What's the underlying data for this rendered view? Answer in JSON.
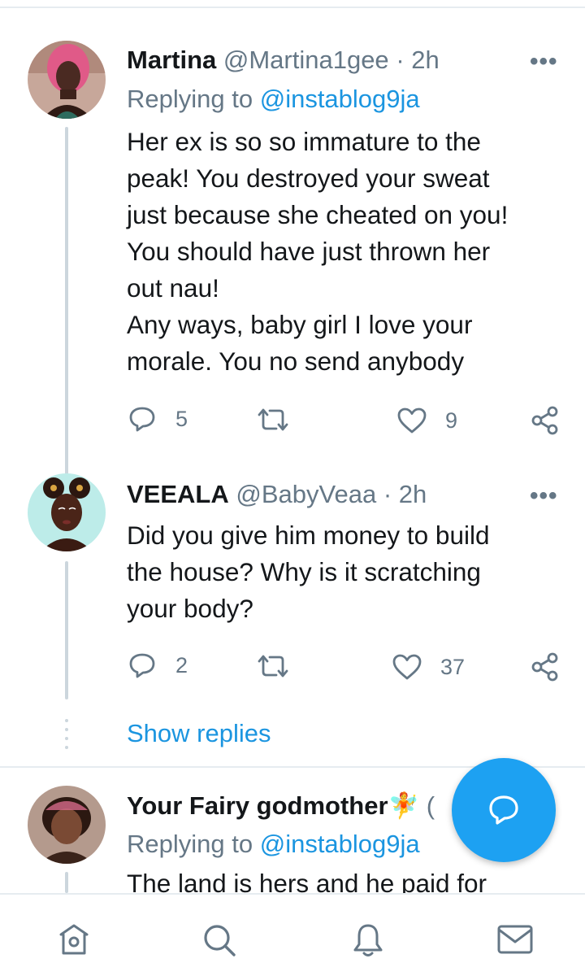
{
  "tweets": [
    {
      "name": "Martina",
      "handle": "@Martina1gee",
      "time": "· 2h",
      "replying_prefix": "Replying to ",
      "replying_to": "@instablog9ja",
      "lines": [
        "Her ex is so so immature to the",
        "peak! You destroyed your sweat",
        "just because she cheated on you!",
        "You should have just thrown her",
        "out nau!",
        "Any ways, baby girl I love your",
        "morale. You no send anybody"
      ],
      "replies": "5",
      "likes": "9"
    },
    {
      "name": "VEEALA",
      "handle": "@BabyVeaa",
      "time": "· 2h",
      "lines": [
        "Did you give him money to build",
        "the house?  Why is it scratching",
        "your body?"
      ],
      "replies": "2",
      "likes": "37"
    },
    {
      "name": "Your Fairy godmother",
      "emoji": "🧚",
      "handle_fragment": "(",
      "replying_prefix": "Replying to ",
      "replying_to": "@instablog9ja",
      "lines": [
        "The land is hers and he paid for"
      ]
    }
  ],
  "show_replies_label": "Show replies",
  "more_glyph": "•••",
  "colors": {
    "accent": "#1da1f2",
    "link": "#1b95e0",
    "muted": "#657786",
    "line": "#ccd6dd"
  },
  "icons": {
    "reply": "reply-icon",
    "retweet": "retweet-icon",
    "like": "heart-icon",
    "share": "share-icon",
    "compose": "compose-reply-icon",
    "nav": [
      "home-icon",
      "search-icon",
      "notifications-icon",
      "messages-icon"
    ]
  }
}
